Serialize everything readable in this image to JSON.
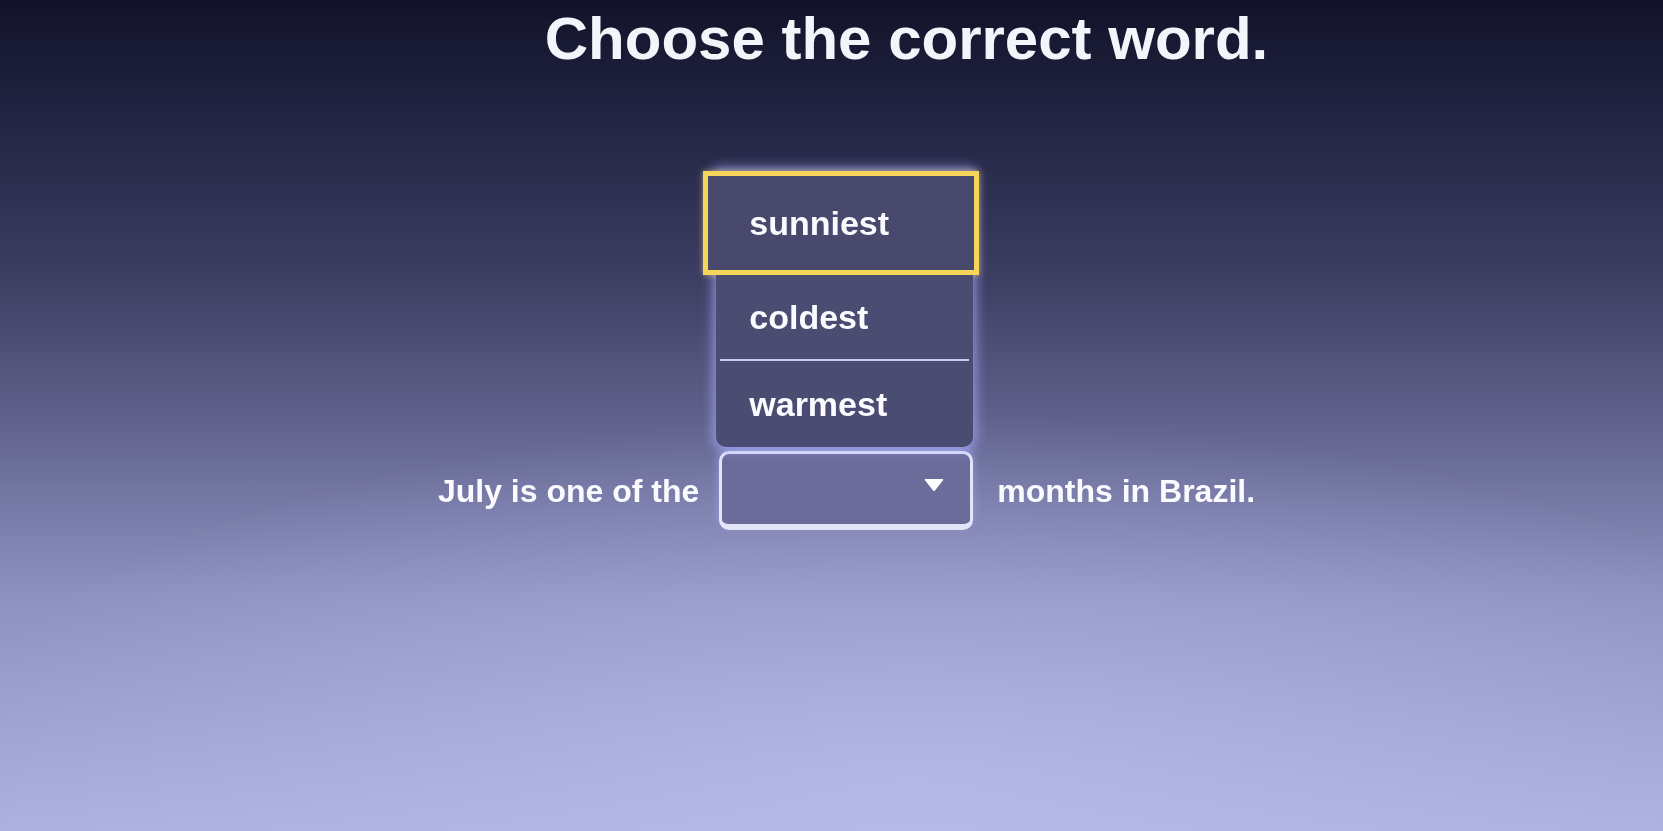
{
  "title": "Choose the correct word.",
  "question": {
    "before": "July is one of the",
    "after": "months in Brazil.",
    "dropdown": {
      "expanded": true,
      "options": [
        {
          "label": "sunniest",
          "selected": true
        },
        {
          "label": "coldest",
          "selected": false
        },
        {
          "label": "warmest",
          "selected": false
        }
      ]
    }
  }
}
